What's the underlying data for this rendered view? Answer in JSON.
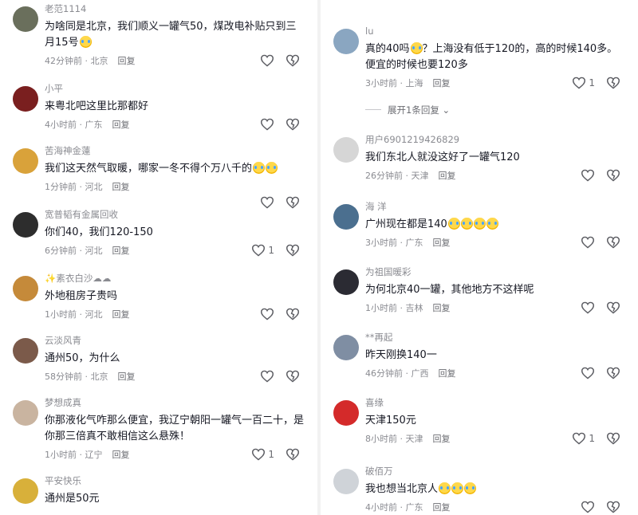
{
  "left": [
    {
      "name": "老范1114",
      "text": "为啥同是北京，我们顺义一罐气50，煤改电补贴只到三月15号",
      "emoji": 1,
      "time": "42分钟前",
      "loc": "北京",
      "reply": "回复",
      "likes": ""
    },
    {
      "name": "小平",
      "text": "来粤北吧这里比那都好",
      "emoji": 0,
      "time": "4小时前",
      "loc": "广东",
      "reply": "回复",
      "likes": ""
    },
    {
      "name": "苦海神金蓮",
      "text": "我们这天然气取暖，哪家一冬不得个万八千的",
      "emoji": 2,
      "time": "1分钟前",
      "loc": "河北",
      "reply": "回复",
      "likes": ""
    },
    {
      "name": "宽普韬有金属回收",
      "text": "你们40，我们120-150",
      "emoji": 0,
      "time": "6分钟前",
      "loc": "河北",
      "reply": "回复",
      "likes": "1"
    },
    {
      "name": "✨素衣白沙☁☁",
      "text": "外地租房子贵吗",
      "emoji": 0,
      "time": "1小时前",
      "loc": "河北",
      "reply": "回复",
      "likes": ""
    },
    {
      "name": "云淡风青",
      "text": "通州50，为什么",
      "emoji": 0,
      "time": "58分钟前",
      "loc": "北京",
      "reply": "回复",
      "likes": ""
    },
    {
      "name": "梦想成真",
      "text": "你那液化气咋那么便宜，我辽宁朝阳一罐气一百二十，是你那三倍真不敢相信这么悬殊！",
      "emoji": 0,
      "time": "1小时前",
      "loc": "辽宁",
      "reply": "回复",
      "likes": "1"
    },
    {
      "name": "平安快乐",
      "text": "通州是50元",
      "emoji": 0,
      "time": "",
      "loc": "",
      "reply": "",
      "likes": ""
    }
  ],
  "right": [
    {
      "name": "lu",
      "text": "真的40吗",
      "text2": "？上海没有低于120的，高的时候140多。便宜的时候也要120多",
      "emoji": 1,
      "time": "3小时前",
      "loc": "上海",
      "reply": "回复",
      "likes": "1"
    },
    {
      "name": "用户6901219426829",
      "text": "我们东北人就没这好了一罐气120",
      "emoji": 0,
      "time": "26分钟前",
      "loc": "天津",
      "reply": "回复",
      "likes": ""
    },
    {
      "name": "海 洋",
      "text": "广州现在都是140",
      "emoji": 4,
      "time": "3小时前",
      "loc": "广东",
      "reply": "回复",
      "likes": ""
    },
    {
      "name": "为祖国暖彩",
      "text": "为何北京40一罐，其他地方不这样呢",
      "emoji": 0,
      "time": "1小时前",
      "loc": "吉林",
      "reply": "回复",
      "likes": ""
    },
    {
      "name": "**再起",
      "text": "昨天刚换140一",
      "emoji": 0,
      "time": "46分钟前",
      "loc": "广西",
      "reply": "回复",
      "likes": ""
    },
    {
      "name": "喜缘",
      "text": "天津150元",
      "emoji": 0,
      "time": "8小时前",
      "loc": "天津",
      "reply": "回复",
      "likes": "1"
    },
    {
      "name": "破佰万",
      "text": "我也想当北京人",
      "emoji": 3,
      "time": "4小时前",
      "loc": "广东",
      "reply": "回复",
      "likes": ""
    }
  ],
  "expand_label": "展开1条回复",
  "icons": {
    "like": "heart-icon",
    "dislike": "broken-heart-icon",
    "chevron": "chevron-down-icon"
  },
  "colors": {
    "text": "#161823",
    "muted": "#8a8b91",
    "icon": "#5c5d63"
  }
}
